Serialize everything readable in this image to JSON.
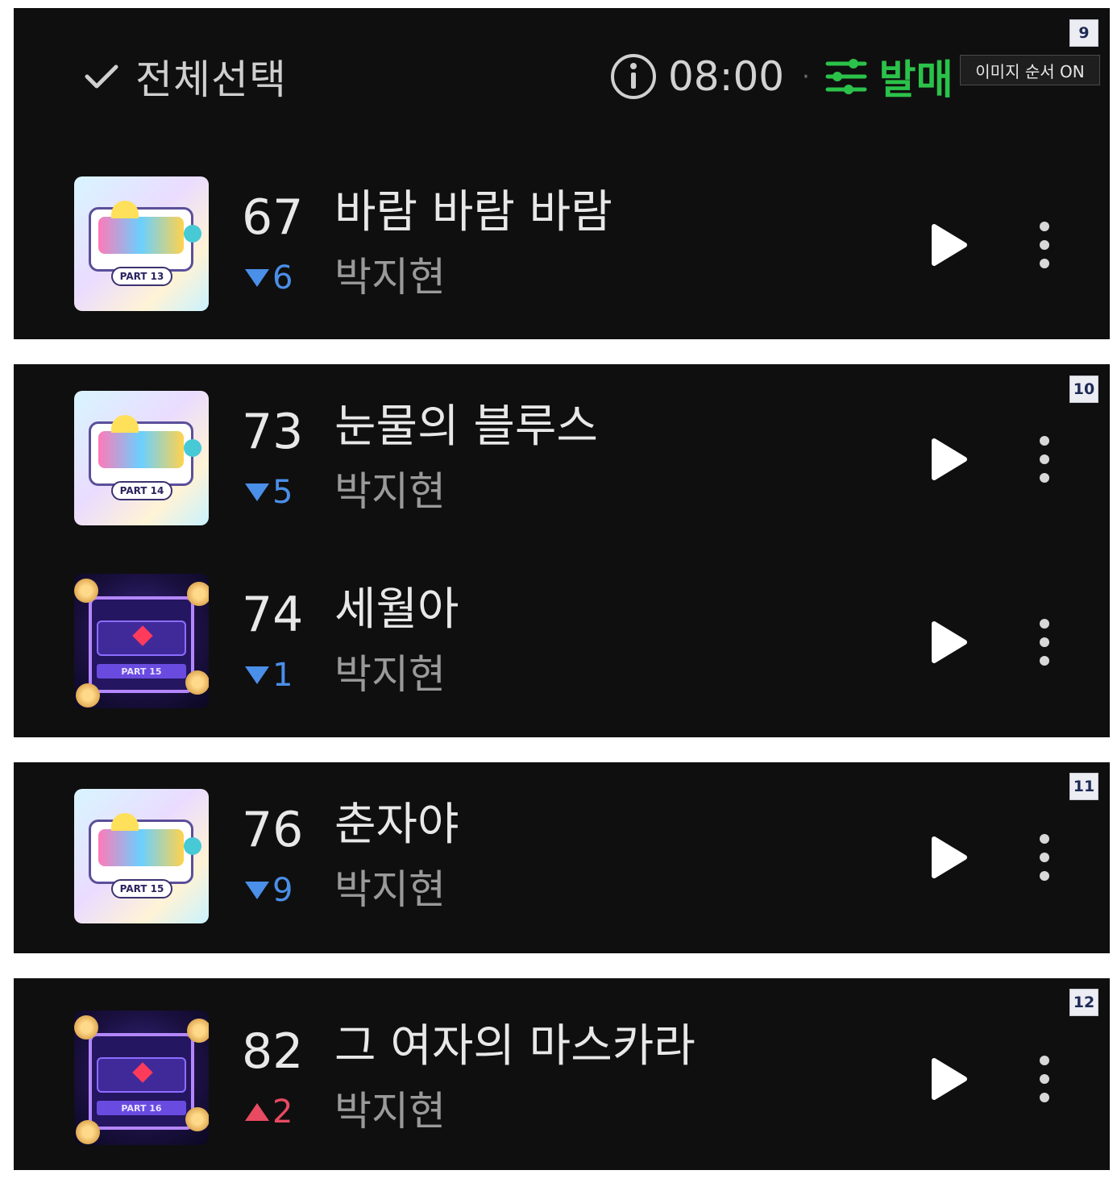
{
  "header": {
    "select_all_label": "전체선택",
    "time": "08:00",
    "separator": "·",
    "sort_label": "발매",
    "order_tooltip": "이미지 순서 ON"
  },
  "panels": [
    {
      "page": "9"
    },
    {
      "page": "10"
    },
    {
      "page": "11"
    },
    {
      "page": "12"
    }
  ],
  "songs": [
    {
      "rank": "67",
      "title": "바람 바람 바람",
      "change_dir": "down",
      "change": "6",
      "artist": "박지현",
      "art": "pastel",
      "part": "PART 13"
    },
    {
      "rank": "73",
      "title": "눈물의 블루스",
      "change_dir": "down",
      "change": "5",
      "artist": "박지현",
      "art": "pastel",
      "part": "PART 14"
    },
    {
      "rank": "74",
      "title": "세월아",
      "change_dir": "down",
      "change": "1",
      "artist": "박지현",
      "art": "purple",
      "part": "PART 15"
    },
    {
      "rank": "76",
      "title": "춘자야",
      "change_dir": "down",
      "change": "9",
      "artist": "박지현",
      "art": "pastel",
      "part": "PART 15"
    },
    {
      "rank": "82",
      "title": "그 여자의 마스카라",
      "change_dir": "up",
      "change": "2",
      "artist": "박지현",
      "art": "purple",
      "part": "PART 16"
    }
  ],
  "colors": {
    "background": "#0f0f0f",
    "accent_green": "#2bc24a",
    "rank_down": "#4a8fe8",
    "rank_up": "#e84a62"
  },
  "icons": [
    "check-icon",
    "info-icon",
    "sliders-icon",
    "play-icon",
    "more-vertical-icon",
    "triangle-down-icon",
    "triangle-up-icon"
  ]
}
